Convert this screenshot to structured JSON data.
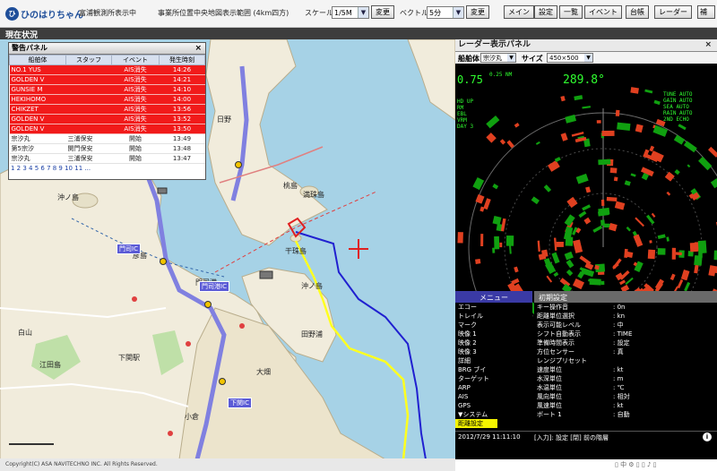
{
  "app": {
    "logo_mark": "ひ",
    "logo_text": "ひのはりちゃん"
  },
  "toolbar": {
    "info_text": "富浦観測所表示中",
    "info_text2": "事業所位置中央地図表示範囲 (4km四方)",
    "scale_label": "スケール",
    "scale_value": "1/5M",
    "level_label": "ベクトル",
    "level_value": "5分",
    "change_btn_1": "変更",
    "change_btn_2": "変更",
    "buttons": [
      "メイン",
      "設定",
      "一覧",
      "イベント",
      "台帳",
      "レーダー",
      "補"
    ]
  },
  "status_title": "現在状況",
  "alarm_panel": {
    "title": "警告パネル",
    "close": "×",
    "columns": [
      "船舶体",
      "スタッフ",
      "イベント",
      "発生時刻"
    ],
    "rows": [
      {
        "ship": "NO.1 YUS",
        "staff": "",
        "event": "AIS消失",
        "time": "14:26",
        "alert": true
      },
      {
        "ship": "GOLDEN V",
        "staff": "",
        "event": "AIS消失",
        "time": "14:21",
        "alert": true
      },
      {
        "ship": "GUNSIE M",
        "staff": "",
        "event": "AIS消失",
        "time": "14:10",
        "alert": true
      },
      {
        "ship": "HEKIHOMO",
        "staff": "",
        "event": "AIS消失",
        "time": "14:00",
        "alert": true
      },
      {
        "ship": "CHIKZET",
        "staff": "",
        "event": "AIS消失",
        "time": "13:56",
        "alert": true
      },
      {
        "ship": "GOLDEN V",
        "staff": "",
        "event": "AIS消失",
        "time": "13:52",
        "alert": true
      },
      {
        "ship": "GOLDEN V",
        "staff": "",
        "event": "AIS消失",
        "time": "13:50",
        "alert": true
      },
      {
        "ship": "宗汐丸",
        "staff": "三浦保安",
        "event": "開始",
        "time": "13:49",
        "alert": false
      },
      {
        "ship": "第5宗汐",
        "staff": "関門保安",
        "event": "開始",
        "time": "13:48",
        "alert": false
      },
      {
        "ship": "宗汐丸",
        "staff": "三浦保安",
        "event": "開始",
        "time": "13:47",
        "alert": false
      }
    ],
    "pagination": "1 2 3 4 5 6 7 8 9 10 11 ..."
  },
  "map": {
    "labels": [
      {
        "id": "kamiya",
        "text": "日野"
      },
      {
        "id": "ushijima",
        "text": "満珠島"
      },
      {
        "id": "okinoshima",
        "text": "沖ノ島"
      },
      {
        "id": "momoshima",
        "text": "桃島"
      },
      {
        "id": "hikoshima",
        "text": "彦島"
      },
      {
        "id": "kanjujima",
        "text": "干珠島"
      },
      {
        "id": "mojiko",
        "text": "門司港"
      },
      {
        "id": "shimonoseki",
        "text": "下関駅"
      },
      {
        "id": "eda",
        "text": "江田島"
      },
      {
        "id": "shiroyama",
        "text": "白山"
      },
      {
        "id": "kokura",
        "text": "小倉"
      },
      {
        "id": "tanoura",
        "text": "田野浦"
      },
      {
        "id": "harbor",
        "text": "沖ノ島"
      },
      {
        "id": "ota",
        "text": "大畑"
      }
    ],
    "ic_badges": [
      "門司IC",
      "門司港IC",
      "下関IC"
    ],
    "copyright": "Copyright(C) ASA NAVITECHNO INC. All Rights Reserved.",
    "colors": {
      "sea": "#a6d2e6",
      "land": "#f1ecdc",
      "yellow_route": "#ffff20",
      "blue_route": "#2020d0",
      "road": "#8080e0"
    }
  },
  "radar_panel": {
    "title": "レーダー表示パネル",
    "close": "×",
    "ship_label": "船舶体",
    "ship_value": "宗汐丸",
    "size_label": "サイズ",
    "size_value": "450×500",
    "range_readout": "0.75",
    "range_sub": "0.25 NM",
    "heading_readout": "289.8°",
    "status_lines": [
      "TUNE AUTO",
      "GAIN AUTO",
      "SEA AUTO",
      "RAIN AUTO",
      "2ND ECHO"
    ],
    "mode_lines": [
      "HD UP",
      "RM",
      "EBL",
      "VRM",
      "DAY 3"
    ],
    "menu_title": "メニュー",
    "menu_items": [
      "エコー",
      "トレイル",
      "マーク",
      "映像 1",
      "映像 2",
      "映像 3",
      "詳細",
      "BRG ブイ",
      "ターゲット",
      "ARP",
      "AIS",
      "GPS",
      "▼システム",
      "距離設定"
    ],
    "menu_selected": "距離設定",
    "settings_title": "初期設定",
    "settings": [
      {
        "k": "キー操作音",
        "v": ": 0n"
      },
      {
        "k": "距離単位選択",
        "v": ": kn"
      },
      {
        "k": "表示可能レベル",
        "v": ": 中"
      },
      {
        "k": "シフト自動表示",
        "v": ": TIME"
      },
      {
        "k": "準備時間表示",
        "v": ": 設定"
      },
      {
        "k": "方位センサー",
        "v": ": 真"
      },
      {
        "k": "レンジプリセット",
        "v": ""
      },
      {
        "k": "速度単位",
        "v": ": kt"
      },
      {
        "k": "水深単位",
        "v": ": m"
      },
      {
        "k": "水温単位",
        "v": ": ℃"
      },
      {
        "k": "風向単位",
        "v": ": 相対"
      },
      {
        "k": "風速単位",
        "v": ": kt"
      },
      {
        "k": "ボート 1",
        "v": ": 自動"
      }
    ],
    "footer_date": "2012/7/29 11:11:10",
    "footer_text": "[入力]: 設定   [閉] 前の階層",
    "info_icon": "i",
    "colors": {
      "echo_red": "#e04020",
      "echo_green": "#10a010",
      "text_green": "#30ff30"
    }
  },
  "tray_text": "▯ 中 ⚙ ▯ ▯ ♪ ▯"
}
